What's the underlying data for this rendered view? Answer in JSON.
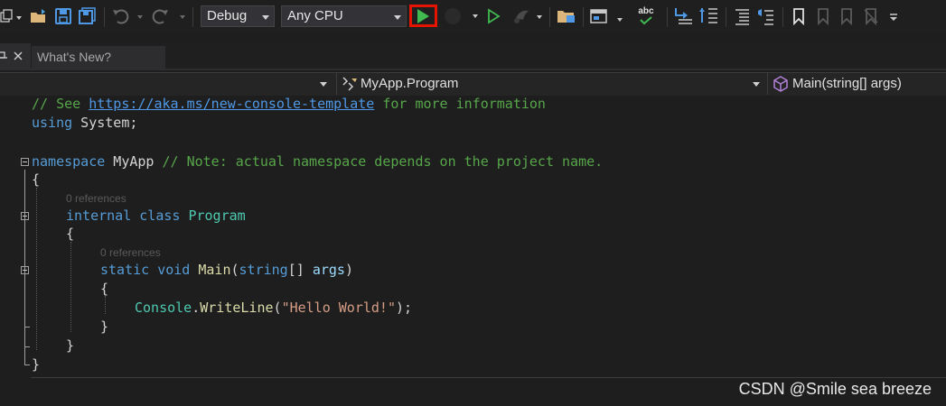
{
  "toolbar": {
    "config_value": "Debug",
    "platform_value": "Any CPU",
    "icons": [
      "new-project-icon",
      "open-folder-icon",
      "save-icon",
      "save-all-icon",
      "undo-icon",
      "redo-icon",
      "start-debug-icon",
      "start-without-debugging-icon",
      "hot-reload-icon",
      "solution-explorer-icon",
      "layout-icon",
      "spellcheck-icon",
      "step-icon",
      "comment-icon",
      "uncomment-icon",
      "bookmark-icon"
    ],
    "spellcheck_label": "abc"
  },
  "tabs": [
    {
      "label": "What's New?"
    }
  ],
  "nav": {
    "type_value": "MyApp.Program",
    "member_value": "Main(string[] args)"
  },
  "code": {
    "line1_comment_prefix": "// See ",
    "line1_link": "https://aka.ms/new-console-template",
    "line1_comment_suffix": " for more information",
    "line2_kw": "using",
    "line2_rest": " System;",
    "ns_kw": "namespace",
    "ns_name": " MyApp ",
    "ns_comment": "// Note: actual namespace depends on the project name.",
    "brace_open": "{",
    "brace_close": "}",
    "lens_class": "0 references",
    "class_kw1": "internal",
    "class_kw2": "class",
    "class_name": "Program",
    "lens_main": "0 references",
    "main_kw1": "static",
    "main_kw2": "void",
    "main_name": "Main",
    "main_paren_open": "(",
    "main_param_type": "string",
    "main_brackets": "[] ",
    "main_param": "args",
    "main_paren_close": ")",
    "console_class": "Console",
    "console_dot": ".",
    "console_method": "WriteLine",
    "console_open": "(",
    "console_string": "\"Hello World!\"",
    "console_close": ");"
  },
  "watermark": "CSDN @Smile sea breeze"
}
